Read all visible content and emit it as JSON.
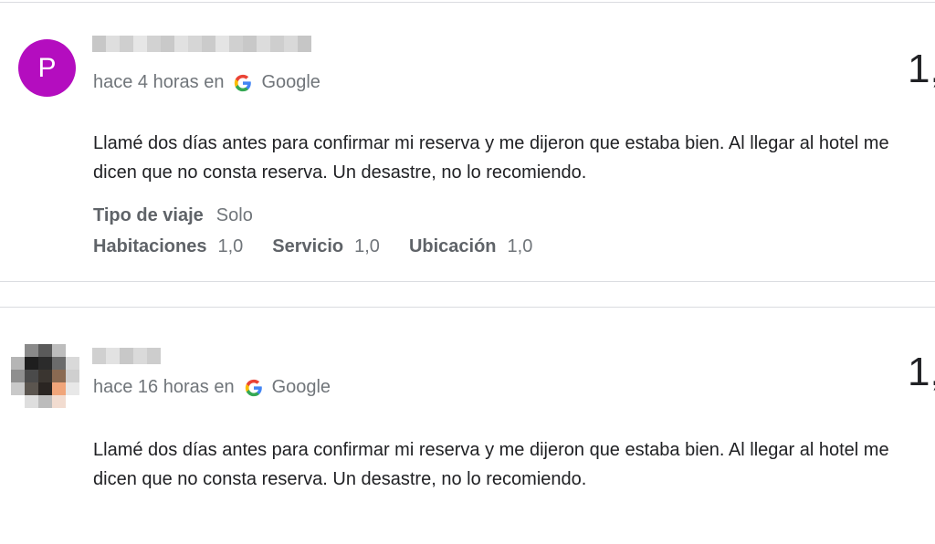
{
  "reviews": [
    {
      "avatar_letter": "P",
      "avatar_color": "#b40dbf",
      "time_prefix": "hace 4 horas en",
      "source": "Google",
      "score": "1,",
      "text": "Llamé dos días antes para confirmar mi reserva y me dijeron que estaba bien. Al llegar al hotel me dicen que no consta reserva. Un desastre, no lo recomiendo.",
      "trip_label": "Tipo de viaje",
      "trip_value": "Solo",
      "ratings": [
        {
          "label": "Habitaciones",
          "value": "1,0"
        },
        {
          "label": "Servicio",
          "value": "1,0"
        },
        {
          "label": "Ubicación",
          "value": "1,0"
        }
      ]
    },
    {
      "time_prefix": "hace 16 horas en",
      "source": "Google",
      "score": "1,",
      "text": "Llamé dos días antes para confirmar mi reserva y me dijeron que estaba bien. Al llegar al hotel me dicen que no consta reserva. Un desastre, no lo recomiendo."
    }
  ],
  "icons": {
    "source_logo": "google-g-icon"
  }
}
